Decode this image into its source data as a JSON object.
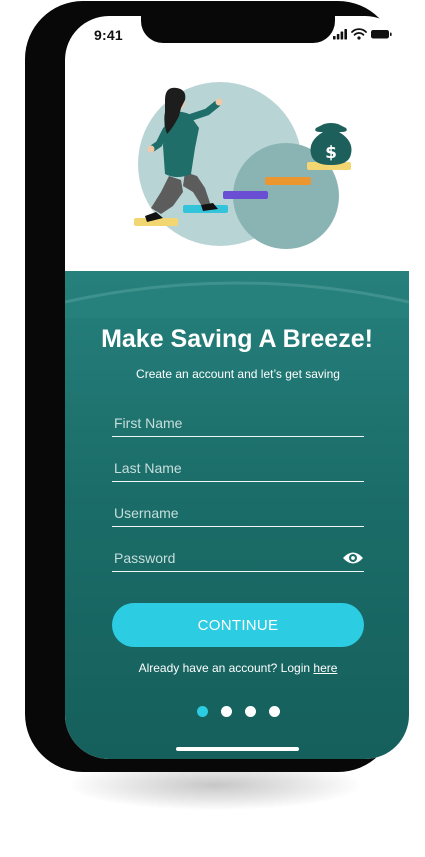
{
  "status_bar": {
    "time": "9:41"
  },
  "onboarding": {
    "headline": "Make Saving A Breeze!",
    "subtitle": "Create an account and let’s get saving"
  },
  "form": {
    "first_name": {
      "placeholder": "First Name",
      "value": ""
    },
    "last_name": {
      "placeholder": "Last Name",
      "value": ""
    },
    "username": {
      "placeholder": "Username",
      "value": ""
    },
    "password": {
      "placeholder": "Password",
      "value": ""
    },
    "continue_label": "CONTINUE"
  },
  "login": {
    "prompt": "Already have an account? Login",
    "link_label": "here"
  },
  "pager": {
    "total": 4,
    "active_index": 0
  },
  "colors": {
    "accent": "#2ccce2",
    "panel_top": "#26807c",
    "panel_bottom": "#155f5c",
    "circle_light": "#b9d4d5",
    "circle_dark": "#8ab4b3"
  }
}
